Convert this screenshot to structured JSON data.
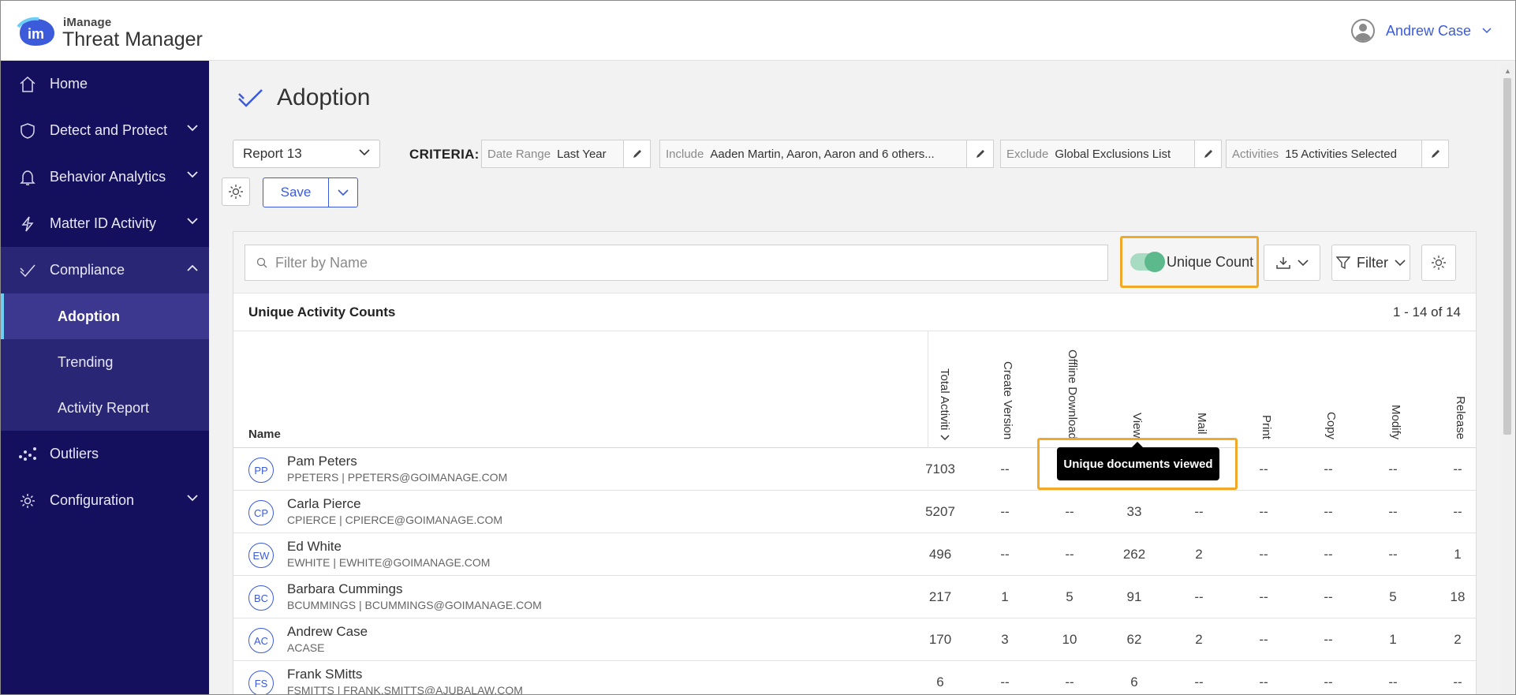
{
  "header": {
    "brand_sub": "iManage",
    "brand_title": "Threat Manager",
    "user_name": "Andrew Case"
  },
  "sidebar": {
    "items": [
      {
        "label": "Home",
        "icon": "home-icon"
      },
      {
        "label": "Detect and Protect",
        "icon": "shield-icon"
      },
      {
        "label": "Behavior Analytics",
        "icon": "bell-icon"
      },
      {
        "label": "Matter ID Activity",
        "icon": "lightning-icon"
      },
      {
        "label": "Compliance",
        "icon": "check-icon"
      },
      {
        "label": "Outliers",
        "icon": "scatter-icon"
      },
      {
        "label": "Configuration",
        "icon": "gear-icon"
      }
    ],
    "compliance_sub": [
      "Adoption",
      "Trending",
      "Activity Report"
    ]
  },
  "page": {
    "title": "Adoption",
    "report_select": "Report 13",
    "criteria_label": "CRITERIA:",
    "criteria": [
      {
        "key": "Date Range",
        "value": "Last Year"
      },
      {
        "key": "Include",
        "value": "Aaden Martin, Aaron, Aaron and 6 others..."
      },
      {
        "key": "Exclude",
        "value": "Global Exclusions List"
      },
      {
        "key": "Activities",
        "value": "15 Activities Selected"
      }
    ],
    "save_label": "Save"
  },
  "panel": {
    "filter_placeholder": "Filter by Name",
    "unique_count_label": "Unique Count",
    "unique_count_on": true,
    "filter_label": "Filter",
    "title": "Unique Activity Counts",
    "count_text": "1 - 14 of 14",
    "name_header": "Name",
    "columns": [
      "Total Activiti",
      "Create Version",
      "Offline Download",
      "View",
      "Mail",
      "Print",
      "Copy",
      "Modify",
      "Release"
    ],
    "rows": [
      {
        "initials": "PP",
        "name": "Pam Peters",
        "sub": "PPETERS | PPETERS@GOIMANAGE.COM",
        "values": [
          "7103",
          "--",
          "",
          "",
          "",
          "--",
          "--",
          "--",
          "--"
        ]
      },
      {
        "initials": "CP",
        "name": "Carla Pierce",
        "sub": "CPIERCE | CPIERCE@GOIMANAGE.COM",
        "values": [
          "5207",
          "--",
          "--",
          "33",
          "--",
          "--",
          "--",
          "--",
          "--"
        ]
      },
      {
        "initials": "EW",
        "name": "Ed White",
        "sub": "EWHITE | EWHITE@GOIMANAGE.COM",
        "values": [
          "496",
          "--",
          "--",
          "262",
          "2",
          "--",
          "--",
          "--",
          "1"
        ]
      },
      {
        "initials": "BC",
        "name": "Barbara Cummings",
        "sub": "BCUMMINGS | BCUMMINGS@GOIMANAGE.COM",
        "values": [
          "217",
          "1",
          "5",
          "91",
          "--",
          "--",
          "--",
          "5",
          "18"
        ]
      },
      {
        "initials": "AC",
        "name": "Andrew Case",
        "sub": "ACASE",
        "values": [
          "170",
          "3",
          "10",
          "62",
          "2",
          "--",
          "--",
          "1",
          "2"
        ]
      },
      {
        "initials": "FS",
        "name": "Frank SMitts",
        "sub": "FSMITTS | FRANK.SMITTS@AJUBALAW.COM",
        "values": [
          "6",
          "--",
          "--",
          "6",
          "--",
          "--",
          "--",
          "--",
          "--"
        ]
      }
    ],
    "tooltip": "Unique documents viewed"
  },
  "colors": {
    "sidebar_bg": "#14105e",
    "accent": "#3b5bdb",
    "highlight": "#f0a928",
    "toggle_on": "#5cb98b"
  }
}
